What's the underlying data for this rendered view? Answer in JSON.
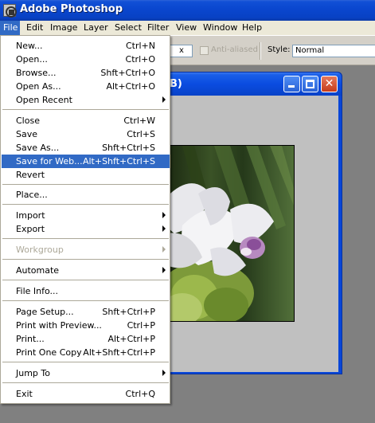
{
  "window": {
    "title": "Adobe Photoshop"
  },
  "menubar": {
    "items": [
      "File",
      "Edit",
      "Image",
      "Layer",
      "Select",
      "Filter",
      "View",
      "Window",
      "Help"
    ],
    "active": "File"
  },
  "options_bar": {
    "partial_field_value": "x",
    "antialiased_label": "Anti-aliased",
    "style_label": "Style:",
    "style_value": "Normal"
  },
  "document": {
    "title_partial": "B)"
  },
  "file_menu": {
    "items": [
      {
        "label": "New...",
        "shortcut": "Ctrl+N"
      },
      {
        "label": "Open...",
        "shortcut": "Ctrl+O"
      },
      {
        "label": "Browse...",
        "shortcut": "Shft+Ctrl+O"
      },
      {
        "label": "Open As...",
        "shortcut": "Alt+Ctrl+O"
      },
      {
        "label": "Open Recent",
        "shortcut": "",
        "submenu": true
      },
      {
        "label": "Close",
        "shortcut": "Ctrl+W"
      },
      {
        "label": "Save",
        "shortcut": "Ctrl+S"
      },
      {
        "label": "Save As...",
        "shortcut": "Shft+Ctrl+S"
      },
      {
        "label": "Save for Web...",
        "shortcut": "Alt+Shft+Ctrl+S",
        "highlighted": true
      },
      {
        "label": "Revert",
        "shortcut": ""
      },
      {
        "label": "Place...",
        "shortcut": ""
      },
      {
        "label": "Import",
        "shortcut": "",
        "submenu": true
      },
      {
        "label": "Export",
        "shortcut": "",
        "submenu": true
      },
      {
        "label": "Workgroup",
        "shortcut": "",
        "submenu": true,
        "disabled": true
      },
      {
        "label": "Automate",
        "shortcut": "",
        "submenu": true
      },
      {
        "label": "File Info...",
        "shortcut": ""
      },
      {
        "label": "Page Setup...",
        "shortcut": "Shft+Ctrl+P"
      },
      {
        "label": "Print with Preview...",
        "shortcut": "Ctrl+P"
      },
      {
        "label": "Print...",
        "shortcut": "Alt+Ctrl+P"
      },
      {
        "label": "Print One Copy",
        "shortcut": "Alt+Shft+Ctrl+P"
      },
      {
        "label": "Jump To",
        "shortcut": "",
        "submenu": true
      },
      {
        "label": "Exit",
        "shortcut": "Ctrl+Q"
      }
    ]
  },
  "colors": {
    "titlebar": "#0a47cf",
    "menubar": "#ece9d8",
    "highlight": "#316ac5",
    "workspace": "#808080"
  }
}
